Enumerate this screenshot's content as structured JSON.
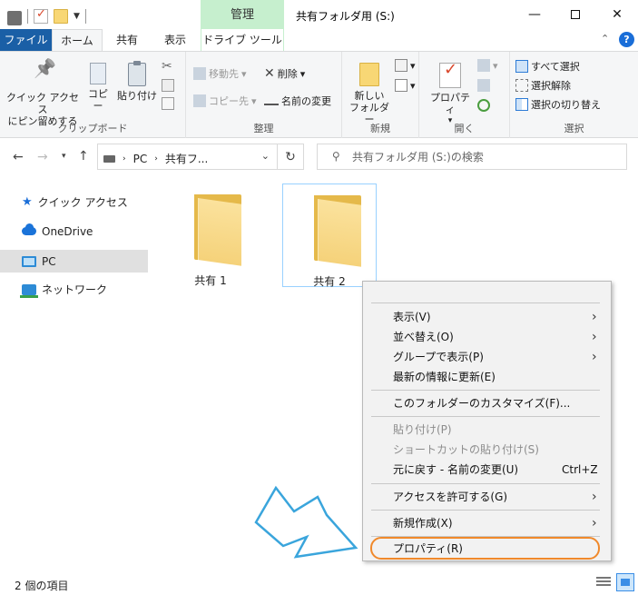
{
  "titlebar": {
    "manage_tab": "管理",
    "title": "共有フォルダ用 (S:)",
    "min_glyph": "—",
    "close_glyph": "✕"
  },
  "tabs": {
    "file": "ファイル",
    "home": "ホーム",
    "share": "共有",
    "view": "表示",
    "drive_tools": "ドライブ ツール"
  },
  "ribbon": {
    "clipboard": {
      "pin": "クイック アクセス\nにピン留めする",
      "copy": "コピー",
      "paste": "貼り付け",
      "label": "クリップボード"
    },
    "organize": {
      "move_to": "移動先",
      "copy_to": "コピー先",
      "delete": "削除",
      "rename": "名前の変更",
      "label": "整理"
    },
    "new": {
      "new_folder": "新しい\nフォルダー",
      "label": "新規"
    },
    "open": {
      "properties": "プロパティ",
      "label": "開く"
    },
    "select": {
      "select_all": "すべて選択",
      "select_none": "選択解除",
      "invert": "選択の切り替え",
      "label": "選択"
    }
  },
  "address": {
    "crumbs": [
      "PC",
      "共有フ..."
    ],
    "search_placeholder": "共有フォルダ用 (S:)の検索"
  },
  "nav": {
    "items": [
      {
        "label": "クイック アクセス"
      },
      {
        "label": "OneDrive"
      },
      {
        "label": "PC"
      },
      {
        "label": "ネットワーク"
      }
    ]
  },
  "content": {
    "folders": [
      {
        "name": "共有 1"
      },
      {
        "name": "共有 2"
      }
    ]
  },
  "context_menu": {
    "items": [
      {
        "label": "表示(V)",
        "submenu": true
      },
      {
        "label": "並べ替え(O)",
        "submenu": true
      },
      {
        "label": "グループで表示(P)",
        "submenu": true
      },
      {
        "label": "最新の情報に更新(E)"
      },
      {
        "label": "このフォルダーのカスタマイズ(F)..."
      },
      {
        "label": "貼り付け(P)",
        "disabled": true
      },
      {
        "label": "ショートカットの貼り付け(S)",
        "disabled": true
      },
      {
        "label": "元に戻す - 名前の変更(U)",
        "shortcut": "Ctrl+Z"
      },
      {
        "label": "アクセスを許可する(G)",
        "submenu": true
      },
      {
        "label": "新規作成(X)",
        "submenu": true
      },
      {
        "label": "プロパティ(R)",
        "highlighted": true
      }
    ],
    "highlight_color": "#F0892B"
  },
  "annotation": {
    "arrow_color": "#3AA5DC"
  },
  "status": {
    "item_count": "2 個の項目"
  },
  "colors": {
    "file_tab": "#1A5FA6",
    "manage_tab": "#C6EFCE",
    "accent_blue": "#1A6ED8"
  }
}
